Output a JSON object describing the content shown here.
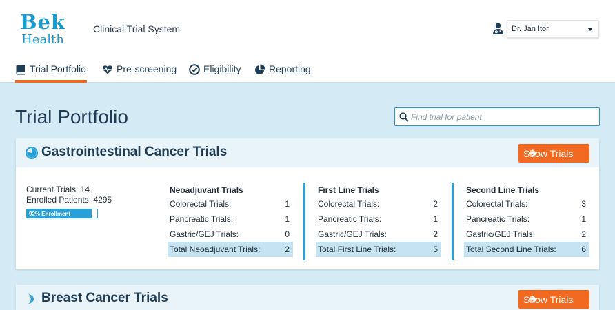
{
  "logo": {
    "line1": "Bek",
    "line2": "Health"
  },
  "system_title": "Clinical Trial System",
  "user": {
    "name": "Dr. Jan Itor"
  },
  "nav": {
    "tabs": [
      {
        "label": "Trial Portfolio",
        "icon": "book-icon",
        "active": true
      },
      {
        "label": "Pre-screening",
        "icon": "heartbeat-icon",
        "active": false
      },
      {
        "label": "Eligibility",
        "icon": "check-circle-icon",
        "active": false
      },
      {
        "label": "Reporting",
        "icon": "pie-chart-icon",
        "active": false
      }
    ]
  },
  "page": {
    "title": "Trial Portfolio",
    "search_placeholder": "Find trial for patient"
  },
  "colors": {
    "accent": "#f26a21",
    "brand": "#1a9bd0",
    "background": "#d4ebf6"
  },
  "cards": [
    {
      "title": "Gastrointestinal Cancer Trials",
      "icon": "pie-progress-icon",
      "button_label": "Show Trials",
      "current_trials": "Current Trials: 14",
      "enrolled_patients": "Enrolled Patients: 4295",
      "enrollment_label": "92% Enrollment",
      "enrollment_fraction": 0.92,
      "columns": [
        {
          "title": "Neoadjuvant Trials",
          "rows": [
            {
              "label": "Colorectal Trials:",
              "value": "1"
            },
            {
              "label": "Pancreatic Trials:",
              "value": "1"
            },
            {
              "label": "Gastric/GEJ Trials:",
              "value": "0"
            }
          ],
          "total": {
            "label": "Total Neoadjuvant Trials:",
            "value": "2"
          }
        },
        {
          "title": "First Line Trials",
          "rows": [
            {
              "label": "Colorectal Trials:",
              "value": "2"
            },
            {
              "label": "Pancreatic Trials:",
              "value": "1"
            },
            {
              "label": "Gastric/GEJ Trials:",
              "value": "2"
            }
          ],
          "total": {
            "label": "Total First Line Trials:",
            "value": "5"
          }
        },
        {
          "title": "Second Line Trials",
          "rows": [
            {
              "label": "Colorectal Trials:",
              "value": "3"
            },
            {
              "label": "Pancreatic Trials:",
              "value": "1"
            },
            {
              "label": "Gastric/GEJ Trials:",
              "value": "2"
            }
          ],
          "total": {
            "label": "Total Second Line Trials:",
            "value": "6"
          }
        }
      ]
    },
    {
      "title": "Breast Cancer Trials",
      "icon": "crescent-icon",
      "button_label": "Show Trials"
    }
  ]
}
